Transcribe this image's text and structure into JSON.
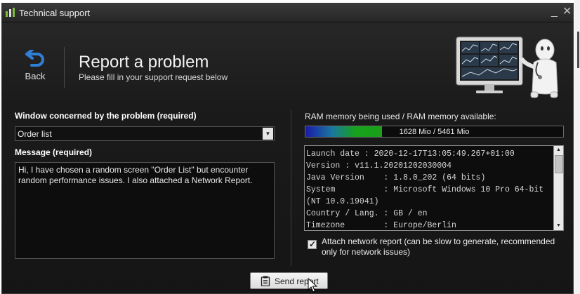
{
  "window": {
    "title": "Technical support"
  },
  "header": {
    "back_label": "Back",
    "title": "Report a problem",
    "subtitle": "Please fill in your support request below"
  },
  "form": {
    "window_label": "Window concerned by the problem (required)",
    "window_value": "Order list",
    "message_label": "Message (required)",
    "message_value": "Hi, I have chosen a random screen \"Order List\" but encounter\nrandom performance issues. I also attached a Network Report."
  },
  "ram": {
    "label": "RAM memory being used / RAM memory available:",
    "used": 1628,
    "available": 5461,
    "display": "1628 Mio / 5461 Mio"
  },
  "system_info": {
    "text": "Launch date : 2020-12-17T13:05:49.267+01:00\nVersion : v11.1.20201202030004\nJava Version    : 1.8.0_202 (64 bits)\nSystem          : Microsoft Windows 10 Pro 64-bit\n(NT 10.0.19041)\nCountry / Lang. : GB / en\nTimezone        : Europe/Berlin"
  },
  "attach_network": {
    "checked": true,
    "label": "Attach network report (can be slow to generate, recommended only for network issues)"
  },
  "actions": {
    "send_label": "Send report"
  },
  "icons": {
    "app": "app-bars-icon",
    "back": "back-arrow-icon",
    "send": "clipboard-icon",
    "illustration": "doctor-monitor-illustration"
  },
  "colors": {
    "background": "#1b1b1b",
    "accent_blue": "#2f7fd6",
    "ram_green": "#17a11c"
  }
}
